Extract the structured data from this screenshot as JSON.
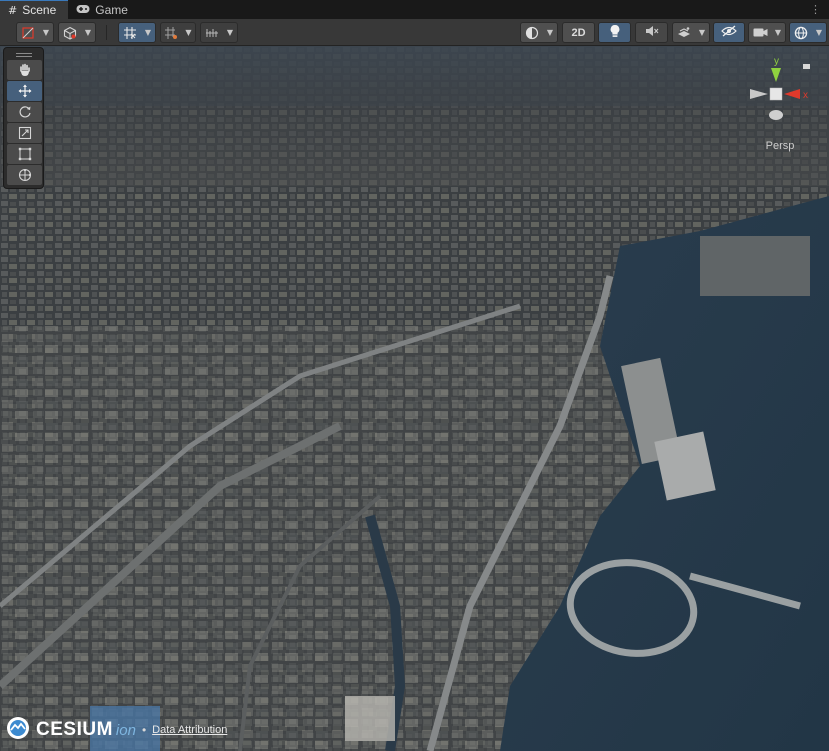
{
  "tabs": [
    {
      "label": "Scene",
      "icon": "grid-icon",
      "active": true
    },
    {
      "label": "Game",
      "icon": "gamepad-icon",
      "active": false
    }
  ],
  "toolbar": {
    "view_2d_label": "2D",
    "accent_color": "#46607c"
  },
  "tools": [
    {
      "name": "hand-tool",
      "icon": "hand-icon",
      "active": false
    },
    {
      "name": "move-tool",
      "icon": "move-arrows-icon",
      "active": true
    },
    {
      "name": "rotate-tool",
      "icon": "rotate-icon",
      "active": false
    },
    {
      "name": "scale-tool",
      "icon": "scale-icon",
      "active": false
    },
    {
      "name": "rect-tool",
      "icon": "rect-transform-icon",
      "active": false
    },
    {
      "name": "transform-tool",
      "icon": "transform-icon",
      "active": false
    }
  ],
  "gizmo": {
    "axis_y": "y",
    "axis_x": "x",
    "projection_label": "Persp",
    "colors": {
      "x": "#e0392b",
      "y": "#8fd13f",
      "z": "#3b83e0"
    }
  },
  "footer": {
    "brand": "CESIUM",
    "brand_suffix": "ion",
    "separator": "•",
    "attribution_link": "Data Attribution"
  }
}
